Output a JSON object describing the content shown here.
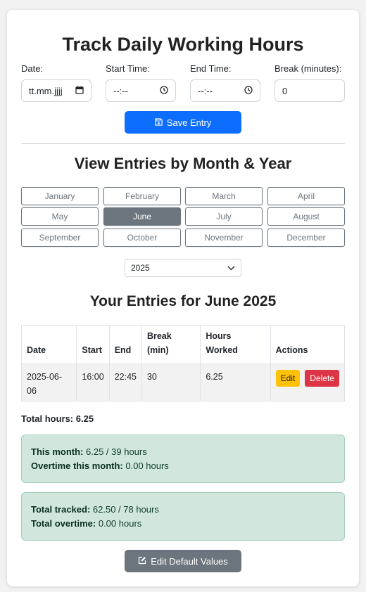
{
  "form": {
    "title": "Track Daily Working Hours",
    "date_label": "Date:",
    "date_value": "tt.mm.jjjj",
    "start_label": "Start Time:",
    "start_value": "--:--",
    "end_label": "End Time:",
    "end_value": "--:--",
    "break_label": "Break (minutes):",
    "break_value": "0",
    "save_label": "Save Entry",
    "icons": {
      "date": "calendar-icon",
      "time": "clock-icon",
      "save": "floppy-disk-icon"
    }
  },
  "viewer": {
    "title": "View Entries by Month & Year",
    "months": [
      "January",
      "February",
      "March",
      "April",
      "May",
      "June",
      "July",
      "August",
      "September",
      "October",
      "November",
      "December"
    ],
    "selected_month": "June",
    "year": "2025"
  },
  "entries": {
    "title": "Your Entries for June 2025",
    "headers": [
      "Date",
      "Start",
      "End",
      "Break (min)",
      "Hours Worked",
      "Actions"
    ],
    "rows": [
      {
        "date": "2025-06-06",
        "start": "16:00",
        "end": "22:45",
        "break": "30",
        "hours": "6.25",
        "edit": "Edit",
        "delete": "Delete"
      }
    ],
    "total_label": "Total hours: 6.25"
  },
  "summary": {
    "month_label": "This month:",
    "month_value": "6.25 / 39 hours",
    "month_ot_label": "Overtime this month:",
    "month_ot_value": "0.00 hours",
    "total_label": "Total tracked:",
    "total_value": "62.50 / 78 hours",
    "total_ot_label": "Total overtime:",
    "total_ot_value": "0.00 hours"
  },
  "footer": {
    "edit_defaults_label": "Edit Default Values",
    "icon": "edit-square-icon"
  },
  "colors": {
    "primary": "#0d6efd",
    "secondary": "#6c757d",
    "warning": "#ffc107",
    "danger": "#dc3545",
    "success_bg": "#d1e7dd"
  }
}
